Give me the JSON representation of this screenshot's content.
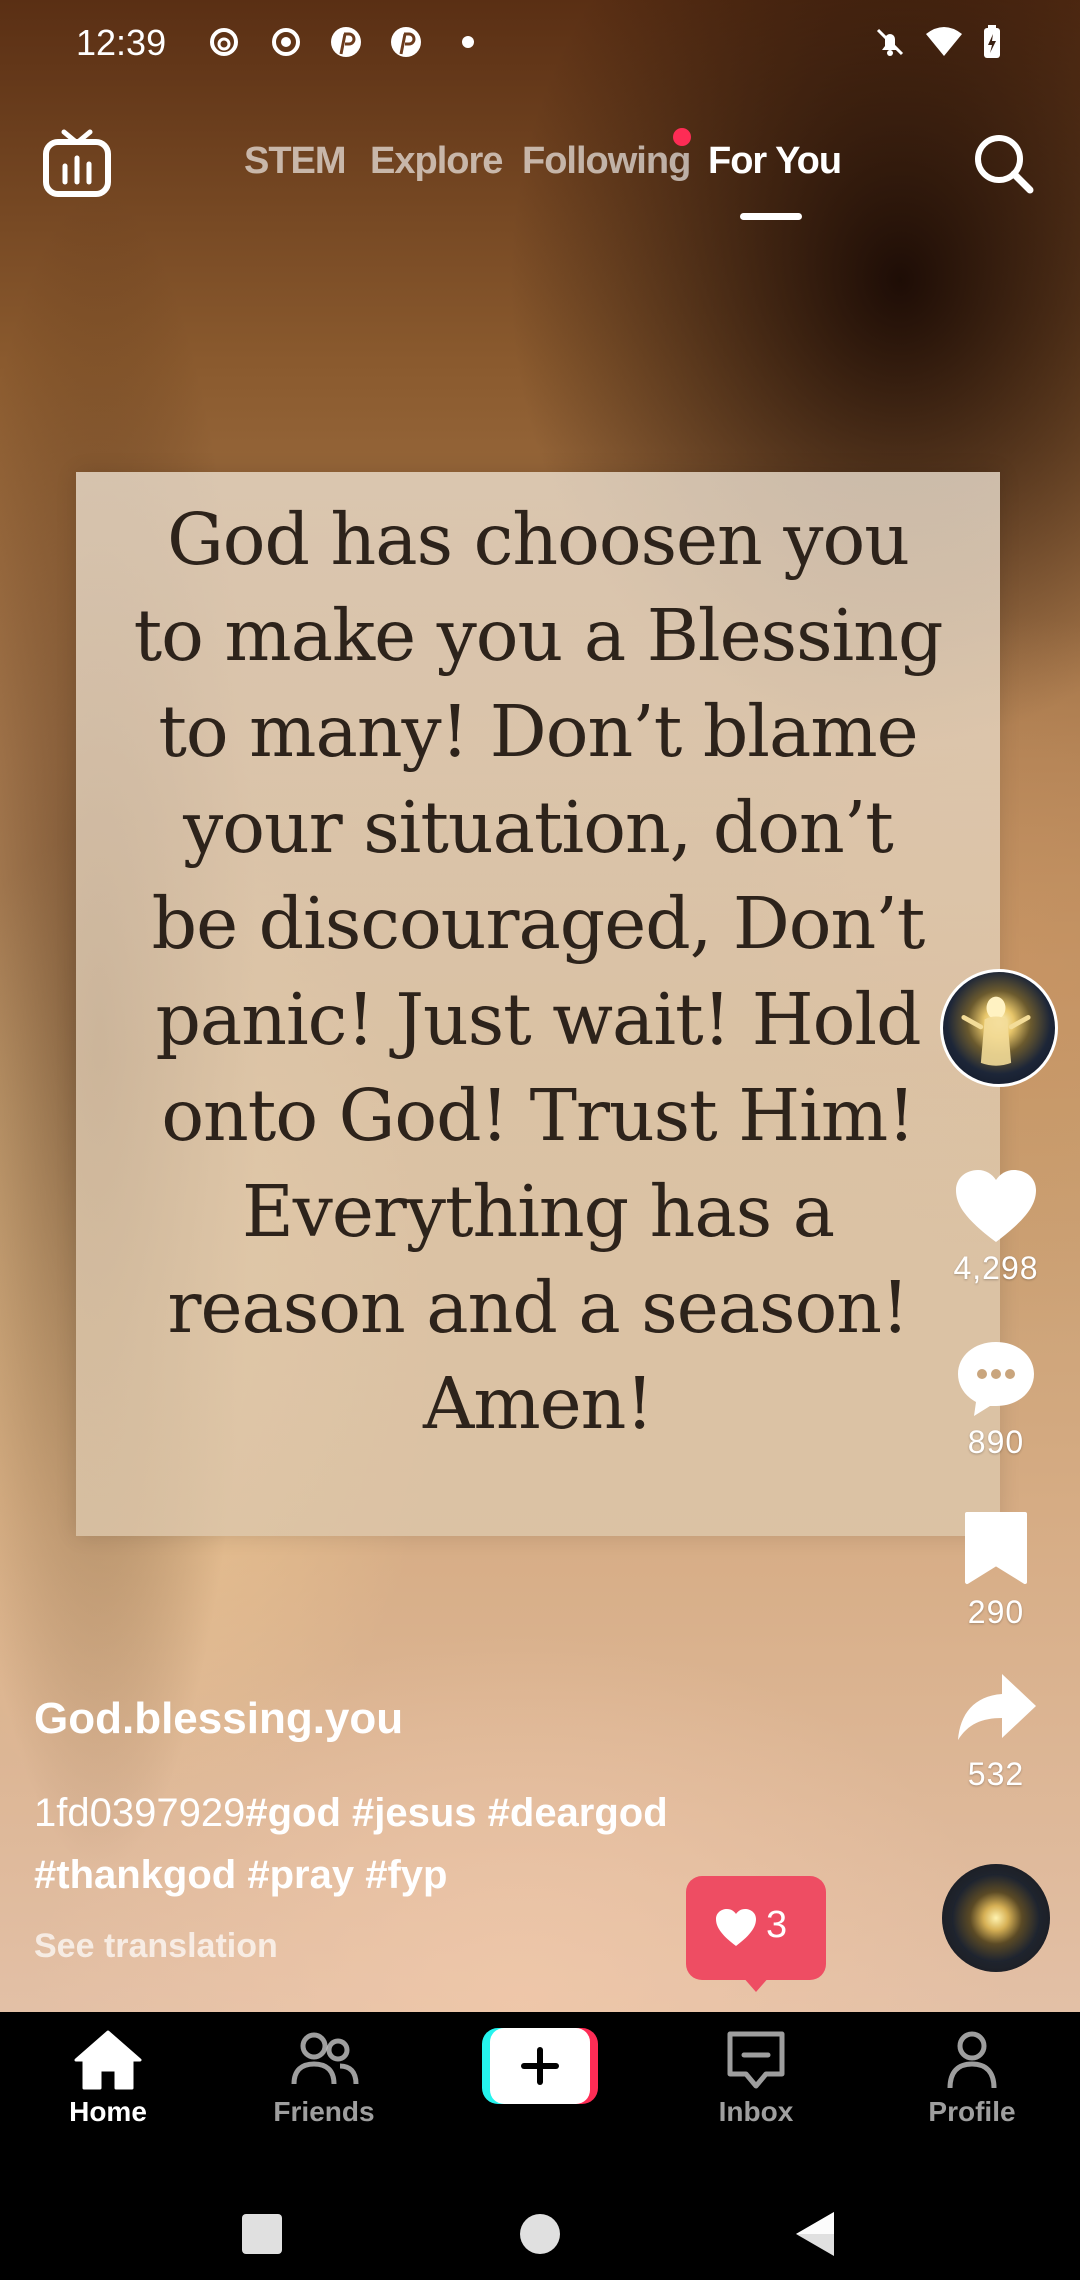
{
  "status_bar": {
    "time": "12:39"
  },
  "top_tabs": [
    "STEM",
    "Explore",
    "Following",
    "For You"
  ],
  "active_tab": "For You",
  "video": {
    "quote_lines": [
      "God has choosen you",
      "to make you a Blessing",
      "to many! Don’t blame",
      "your situation, don’t",
      "be discouraged, Don’t",
      "panic! Just wait! Hold",
      "onto God! Trust Him!",
      "Everything has a",
      "reason and a season!",
      "Amen!"
    ]
  },
  "actions": {
    "likes": "4,298",
    "comments": "890",
    "saves": "290",
    "shares": "532"
  },
  "post": {
    "username": "God.blessing.you",
    "caption_prefix": "1fd0397929",
    "caption_tags_line1": "#god #jesus #deargod",
    "caption_tags_line2": "#thankgod #pray #fyp",
    "see_translation": "See translation"
  },
  "notification": {
    "count": "3"
  },
  "bottom_nav": {
    "home": "Home",
    "friends": "Friends",
    "inbox": "Inbox",
    "profile": "Profile"
  },
  "colors": {
    "accent": "#fe2c55",
    "notification": "#ee4d63",
    "create_cyan": "#25f4ee"
  },
  "icons": {
    "status": [
      "threads-icon",
      "record-icon",
      "pinterest-icon",
      "pinterest-icon",
      "dot-icon",
      "bell-off-icon",
      "wifi-icon",
      "battery-charging-icon"
    ]
  }
}
